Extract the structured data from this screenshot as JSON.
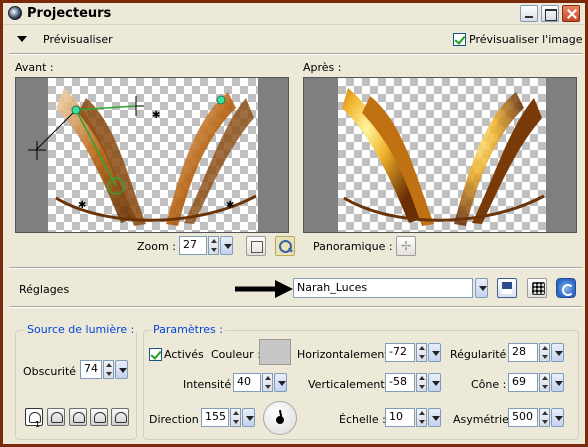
{
  "window": {
    "title": "Projecteurs"
  },
  "preview_bar": {
    "toggle_label": "Prévisualiser",
    "preview_image_checkbox": "Prévisualiser l'image",
    "preview_image_checked": true
  },
  "before": {
    "label": "Avant :"
  },
  "after": {
    "label": "Après :"
  },
  "zoom": {
    "label": "Zoom :",
    "value": "27"
  },
  "pan": {
    "label": "Panoramique :"
  },
  "settings": {
    "label": "Réglages",
    "preset_value": "Narah_Luces"
  },
  "light_source": {
    "title": "Source de lumière :",
    "obscurity_label": "Obscurité :",
    "obscurity_value": "74",
    "selected_shape_badge": "1"
  },
  "parameters": {
    "title": "Paramètres :",
    "active_label": "Activés",
    "active_checked": true,
    "color_label": "Couleur :",
    "intensity_label": "Intensité :",
    "intensity_value": "40",
    "direction_label": "Direction :",
    "direction_value": "155",
    "horizontal_label": "Horizontalement :",
    "horizontal_value": "-72",
    "vertical_label": "Verticalement :",
    "vertical_value": "-58",
    "scale_label": "Échelle :",
    "scale_value": "10",
    "regularity_label": "Régularité :",
    "regularity_value": "28",
    "cone_label": "Cône :",
    "cone_value": "69",
    "asymmetry_label": "Asymétrie :",
    "asymmetry_value": "500"
  },
  "colors": {
    "window_border": "#7A2A08",
    "swatch": "#C7C7C7",
    "accent_title": "#0046D5"
  }
}
